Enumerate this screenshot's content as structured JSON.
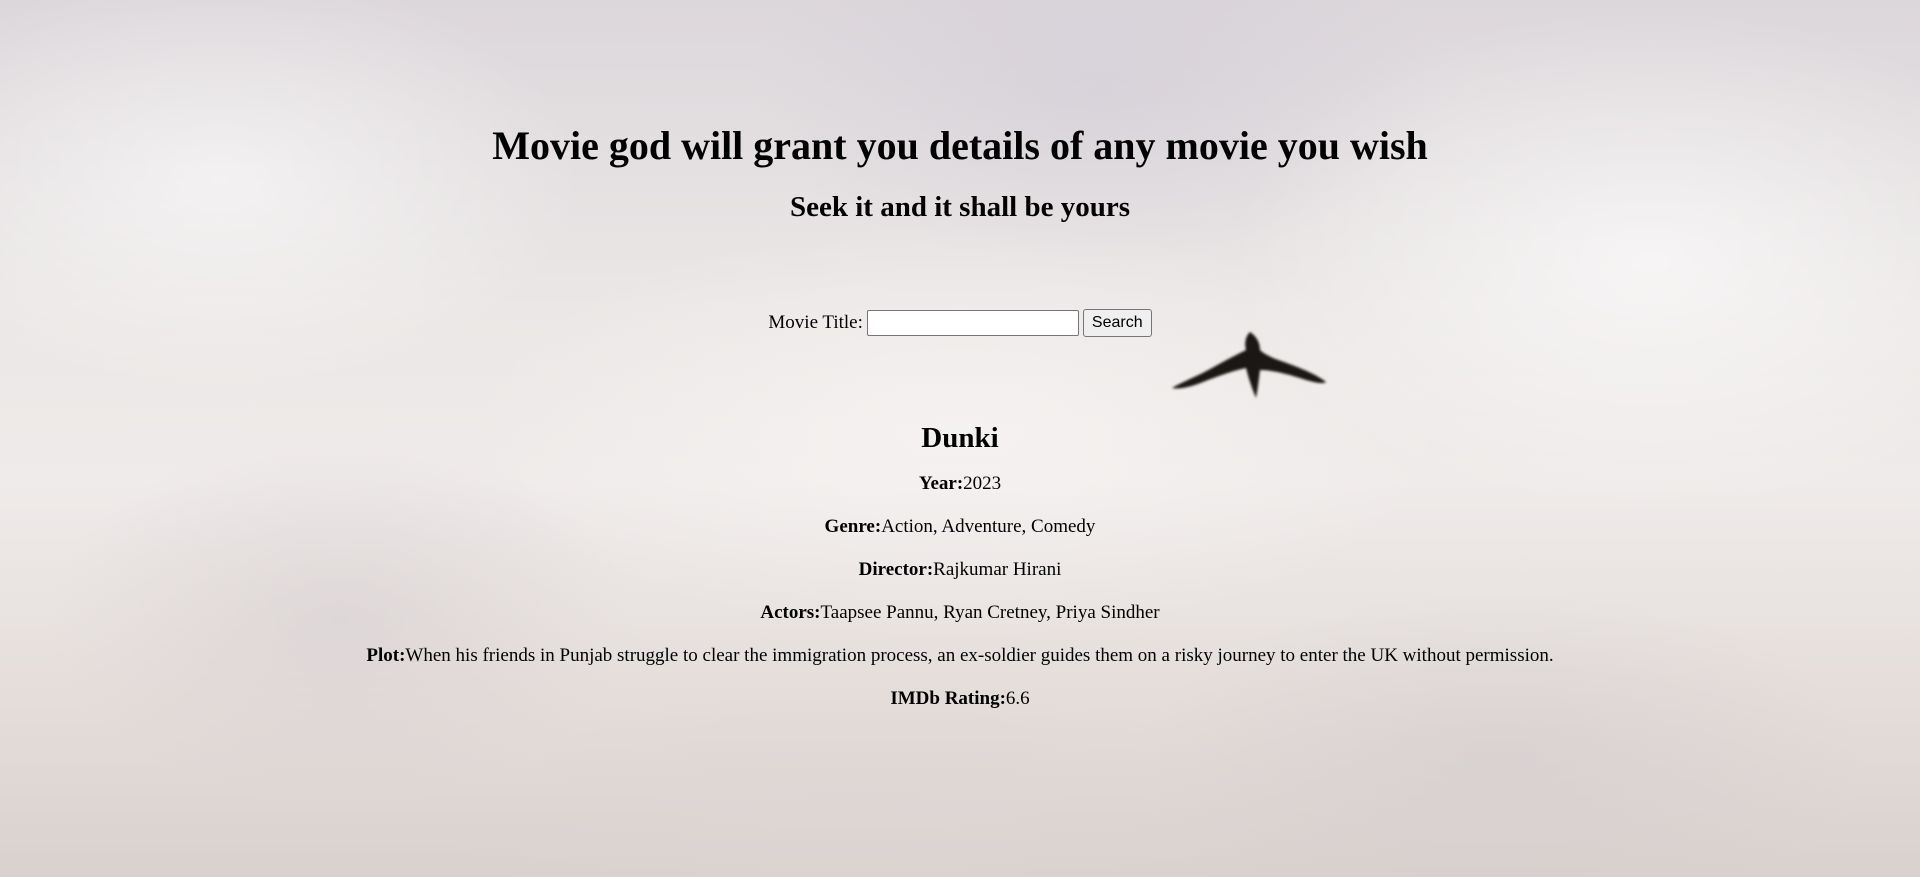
{
  "header": {
    "title": "Movie god will grant you details of any movie you wish",
    "subtitle": "Seek it and it shall be yours"
  },
  "search": {
    "label": "Movie Title:",
    "value": "",
    "placeholder": "",
    "button_label": "Search"
  },
  "movie": {
    "title": "Dunki",
    "fields": {
      "year": {
        "label": "Year:",
        "value": "2023"
      },
      "genre": {
        "label": "Genre:",
        "value": "Action, Adventure, Comedy"
      },
      "director": {
        "label": "Director:",
        "value": "Rajkumar Hirani"
      },
      "actors": {
        "label": "Actors:",
        "value": "Taapsee Pannu, Ryan Cretney, Priya Sindher"
      },
      "plot": {
        "label": "Plot:",
        "value": "When his friends in Punjab struggle to clear the immigration process, an ex-soldier guides them on a risky journey to enter the UK without permission."
      },
      "rating": {
        "label": "IMDb Rating:",
        "value": "6.6"
      }
    }
  },
  "background": {
    "image": "cloudy-sky-with-bird",
    "bird_icon": "bird-silhouette"
  }
}
